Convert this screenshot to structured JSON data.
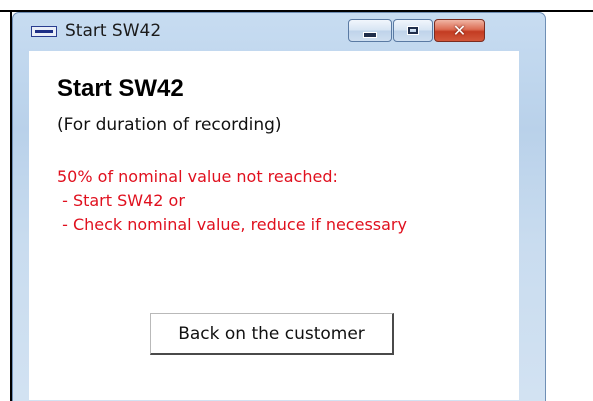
{
  "window": {
    "title": "Start SW42",
    "controls": {
      "minimize_icon": "minimize-icon",
      "maximize_icon": "maximize-icon",
      "close_icon": "close-icon"
    }
  },
  "dialog": {
    "heading": "Start SW42",
    "subtitle": "(For duration of recording)",
    "messages": [
      "50% of nominal value not reached:",
      " - Start SW42 or",
      " - Check nominal value, reduce if necessary"
    ],
    "button_label": "Back on the customer"
  },
  "colors": {
    "warning_text": "#e0101e",
    "close_button": "#c33b22"
  }
}
